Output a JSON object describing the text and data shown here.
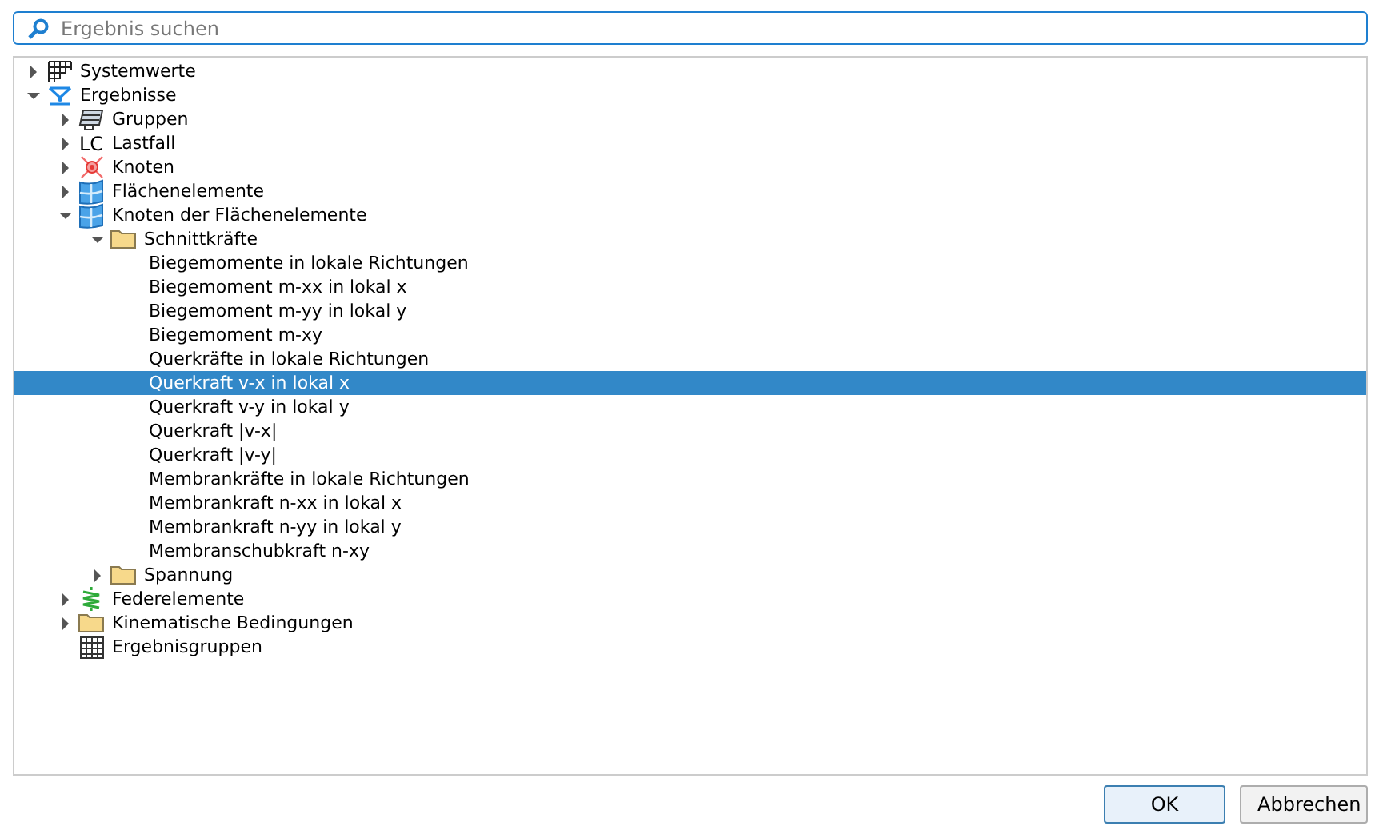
{
  "search": {
    "placeholder": "Ergebnis suchen"
  },
  "tree": [
    {
      "label": "Systemwerte",
      "kind": "grid",
      "expanded": false,
      "selected": false
    },
    {
      "label": "Ergebnisse",
      "kind": "results",
      "expanded": true,
      "selected": false,
      "children": [
        {
          "label": "Gruppen",
          "kind": "groups",
          "expanded": false,
          "selected": false
        },
        {
          "label": "Lastfall",
          "kind": "text",
          "icon_text": "LC",
          "expanded": false,
          "selected": false
        },
        {
          "label": "Knoten",
          "kind": "node",
          "expanded": false,
          "selected": false
        },
        {
          "label": "Flächenelemente",
          "kind": "surface",
          "expanded": false,
          "selected": false
        },
        {
          "label": "Knoten der Flächenelemente",
          "kind": "surface",
          "expanded": true,
          "selected": false,
          "children": [
            {
              "label": "Schnittkräfte",
              "kind": "folder",
              "expanded": true,
              "selected": false,
              "children": [
                {
                  "label": "Biegemomente in lokale Richtungen",
                  "selected": false
                },
                {
                  "label": "Biegemoment m-xx in lokal x",
                  "selected": false
                },
                {
                  "label": "Biegemoment m-yy in lokal y",
                  "selected": false
                },
                {
                  "label": "Biegemoment m-xy",
                  "selected": false
                },
                {
                  "label": "Querkräfte in lokale Richtungen",
                  "selected": false
                },
                {
                  "label": "Querkraft v-x in lokal x",
                  "selected": true
                },
                {
                  "label": "Querkraft v-y in lokal y",
                  "selected": false
                },
                {
                  "label": "Querkraft |v-x|",
                  "selected": false
                },
                {
                  "label": "Querkraft |v-y|",
                  "selected": false
                },
                {
                  "label": "Membrankräfte in lokale Richtungen",
                  "selected": false
                },
                {
                  "label": "Membrankraft n-xx in lokal x",
                  "selected": false
                },
                {
                  "label": "Membrankraft n-yy in lokal y",
                  "selected": false
                },
                {
                  "label": "Membranschubkraft n-xy",
                  "selected": false
                }
              ]
            },
            {
              "label": "Spannung",
              "kind": "folder",
              "expanded": false,
              "selected": false
            }
          ]
        },
        {
          "label": "Federelemente",
          "kind": "spring",
          "expanded": false,
          "selected": false
        },
        {
          "label": "Kinematische Bedingungen",
          "kind": "folder",
          "expanded": false,
          "selected": false
        },
        {
          "label": "Ergebnisgruppen",
          "kind": "table",
          "selected": false
        }
      ]
    }
  ],
  "buttons": [
    {
      "label": "OK",
      "kind": "default"
    },
    {
      "label": "Abbrechen",
      "kind": "normal"
    }
  ]
}
